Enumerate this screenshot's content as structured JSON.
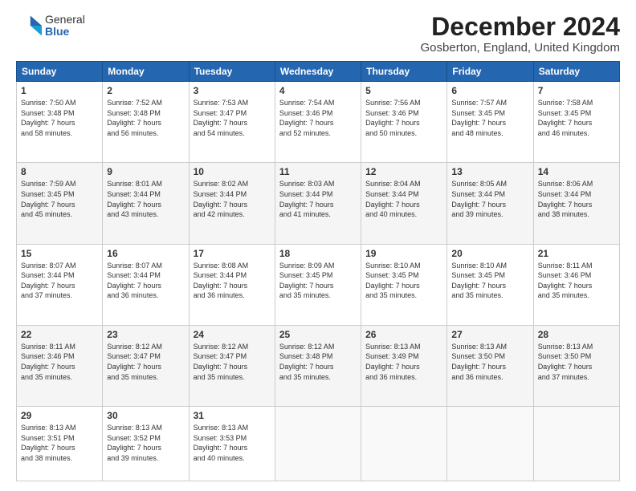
{
  "logo": {
    "general": "General",
    "blue": "Blue"
  },
  "title": "December 2024",
  "location": "Gosberton, England, United Kingdom",
  "days_header": [
    "Sunday",
    "Monday",
    "Tuesday",
    "Wednesday",
    "Thursday",
    "Friday",
    "Saturday"
  ],
  "weeks": [
    [
      {
        "day": "1",
        "sunrise": "7:50 AM",
        "sunset": "3:48 PM",
        "daylight": "7 hours and 58 minutes."
      },
      {
        "day": "2",
        "sunrise": "7:52 AM",
        "sunset": "3:48 PM",
        "daylight": "7 hours and 56 minutes."
      },
      {
        "day": "3",
        "sunrise": "7:53 AM",
        "sunset": "3:47 PM",
        "daylight": "7 hours and 54 minutes."
      },
      {
        "day": "4",
        "sunrise": "7:54 AM",
        "sunset": "3:46 PM",
        "daylight": "7 hours and 52 minutes."
      },
      {
        "day": "5",
        "sunrise": "7:56 AM",
        "sunset": "3:46 PM",
        "daylight": "7 hours and 50 minutes."
      },
      {
        "day": "6",
        "sunrise": "7:57 AM",
        "sunset": "3:45 PM",
        "daylight": "7 hours and 48 minutes."
      },
      {
        "day": "7",
        "sunrise": "7:58 AM",
        "sunset": "3:45 PM",
        "daylight": "7 hours and 46 minutes."
      }
    ],
    [
      {
        "day": "8",
        "sunrise": "7:59 AM",
        "sunset": "3:45 PM",
        "daylight": "7 hours and 45 minutes."
      },
      {
        "day": "9",
        "sunrise": "8:01 AM",
        "sunset": "3:44 PM",
        "daylight": "7 hours and 43 minutes."
      },
      {
        "day": "10",
        "sunrise": "8:02 AM",
        "sunset": "3:44 PM",
        "daylight": "7 hours and 42 minutes."
      },
      {
        "day": "11",
        "sunrise": "8:03 AM",
        "sunset": "3:44 PM",
        "daylight": "7 hours and 41 minutes."
      },
      {
        "day": "12",
        "sunrise": "8:04 AM",
        "sunset": "3:44 PM",
        "daylight": "7 hours and 40 minutes."
      },
      {
        "day": "13",
        "sunrise": "8:05 AM",
        "sunset": "3:44 PM",
        "daylight": "7 hours and 39 minutes."
      },
      {
        "day": "14",
        "sunrise": "8:06 AM",
        "sunset": "3:44 PM",
        "daylight": "7 hours and 38 minutes."
      }
    ],
    [
      {
        "day": "15",
        "sunrise": "8:07 AM",
        "sunset": "3:44 PM",
        "daylight": "7 hours and 37 minutes."
      },
      {
        "day": "16",
        "sunrise": "8:07 AM",
        "sunset": "3:44 PM",
        "daylight": "7 hours and 36 minutes."
      },
      {
        "day": "17",
        "sunrise": "8:08 AM",
        "sunset": "3:44 PM",
        "daylight": "7 hours and 36 minutes."
      },
      {
        "day": "18",
        "sunrise": "8:09 AM",
        "sunset": "3:45 PM",
        "daylight": "7 hours and 35 minutes."
      },
      {
        "day": "19",
        "sunrise": "8:10 AM",
        "sunset": "3:45 PM",
        "daylight": "7 hours and 35 minutes."
      },
      {
        "day": "20",
        "sunrise": "8:10 AM",
        "sunset": "3:45 PM",
        "daylight": "7 hours and 35 minutes."
      },
      {
        "day": "21",
        "sunrise": "8:11 AM",
        "sunset": "3:46 PM",
        "daylight": "7 hours and 35 minutes."
      }
    ],
    [
      {
        "day": "22",
        "sunrise": "8:11 AM",
        "sunset": "3:46 PM",
        "daylight": "7 hours and 35 minutes."
      },
      {
        "day": "23",
        "sunrise": "8:12 AM",
        "sunset": "3:47 PM",
        "daylight": "7 hours and 35 minutes."
      },
      {
        "day": "24",
        "sunrise": "8:12 AM",
        "sunset": "3:47 PM",
        "daylight": "7 hours and 35 minutes."
      },
      {
        "day": "25",
        "sunrise": "8:12 AM",
        "sunset": "3:48 PM",
        "daylight": "7 hours and 35 minutes."
      },
      {
        "day": "26",
        "sunrise": "8:13 AM",
        "sunset": "3:49 PM",
        "daylight": "7 hours and 36 minutes."
      },
      {
        "day": "27",
        "sunrise": "8:13 AM",
        "sunset": "3:50 PM",
        "daylight": "7 hours and 36 minutes."
      },
      {
        "day": "28",
        "sunrise": "8:13 AM",
        "sunset": "3:50 PM",
        "daylight": "7 hours and 37 minutes."
      }
    ],
    [
      {
        "day": "29",
        "sunrise": "8:13 AM",
        "sunset": "3:51 PM",
        "daylight": "7 hours and 38 minutes."
      },
      {
        "day": "30",
        "sunrise": "8:13 AM",
        "sunset": "3:52 PM",
        "daylight": "7 hours and 39 minutes."
      },
      {
        "day": "31",
        "sunrise": "8:13 AM",
        "sunset": "3:53 PM",
        "daylight": "7 hours and 40 minutes."
      },
      null,
      null,
      null,
      null
    ]
  ],
  "labels": {
    "sunrise": "Sunrise:",
    "sunset": "Sunset:",
    "daylight": "Daylight hours"
  }
}
